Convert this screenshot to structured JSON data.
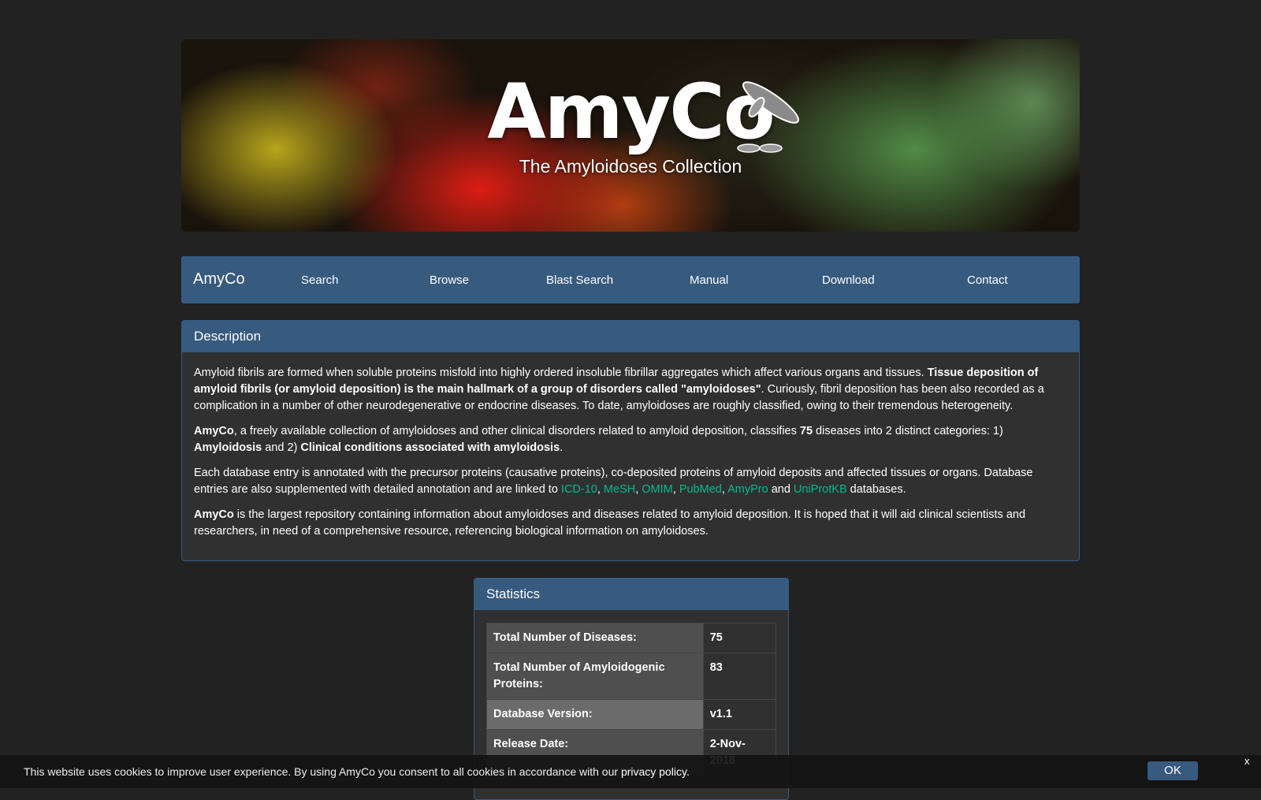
{
  "banner": {
    "logo_text": "AmyCo",
    "tagline": "The Amyloidoses Collection"
  },
  "navbar": {
    "brand": "AmyCo",
    "items": [
      "Search",
      "Browse",
      "Blast Search",
      "Manual",
      "Download",
      "Contact"
    ]
  },
  "description": {
    "heading": "Description",
    "p1_a": "Amyloid fibrils are formed when soluble proteins misfold into highly ordered insoluble fibrillar aggregates which affect various organs and tissues. ",
    "p1_b": "Tissue deposition of amyloid fibrils (or amyloid deposition) is the main hallmark of a group of disorders called \"amyloidoses\"",
    "p1_c": ". Curiously, fibril deposition has been also recorded as a complication in a number of other neurodegenerative or endocrine diseases. To date, amyloidoses are roughly classified, owing to their tremendous heterogeneity.",
    "p2_a": "AmyCo",
    "p2_b": ", a freely available collection of amyloidoses and other clinical disorders related to amyloid deposition, classifies ",
    "p2_c": "75",
    "p2_d": " diseases into 2 distinct categories: 1) ",
    "p2_e": "Amyloidosis",
    "p2_f": " and 2) ",
    "p2_g": "Clinical conditions associated with amyloidosis",
    "p2_h": ".",
    "p3_a": "Each database entry is annotated with the precursor proteins (causative proteins), co-deposited proteins of amyloid deposits and affected tissues or organs. Database entries are also supplemented with detailed annotation and are linked to ",
    "links": [
      "ICD-10",
      "MeSH",
      "OMIM",
      "PubMed",
      "AmyPro",
      "UniProtKB"
    ],
    "comma": ", ",
    "and": " and ",
    "p3_end": " databases.",
    "p4_a": "AmyCo",
    "p4_b": " is the largest repository containing information about amyloidoses and diseases related to amyloid deposition. It is hoped that it will aid clinical scientists and researchers, in need of a comprehensive resource, referencing biological information on amyloidoses."
  },
  "statistics": {
    "heading": "Statistics",
    "rows": [
      {
        "label": "Total Number of Diseases:",
        "value": "75"
      },
      {
        "label": "Total Number of Amyloidogenic Proteins:",
        "value": "83"
      },
      {
        "label": "Database Version:",
        "value": "v1.1"
      },
      {
        "label": "Release Date:",
        "value": "2-Nov-2018"
      }
    ]
  },
  "cookie": {
    "message": "This website uses cookies to improve user experience. By using AmyCo you consent to all cookies in accordance with our ",
    "link": "privacy policy",
    "end": ".",
    "ok": "OK",
    "close": "x"
  },
  "colors": {
    "background": "#222222",
    "primary": "#375a7f",
    "link": "#00bc8c",
    "panel": "#303030"
  }
}
